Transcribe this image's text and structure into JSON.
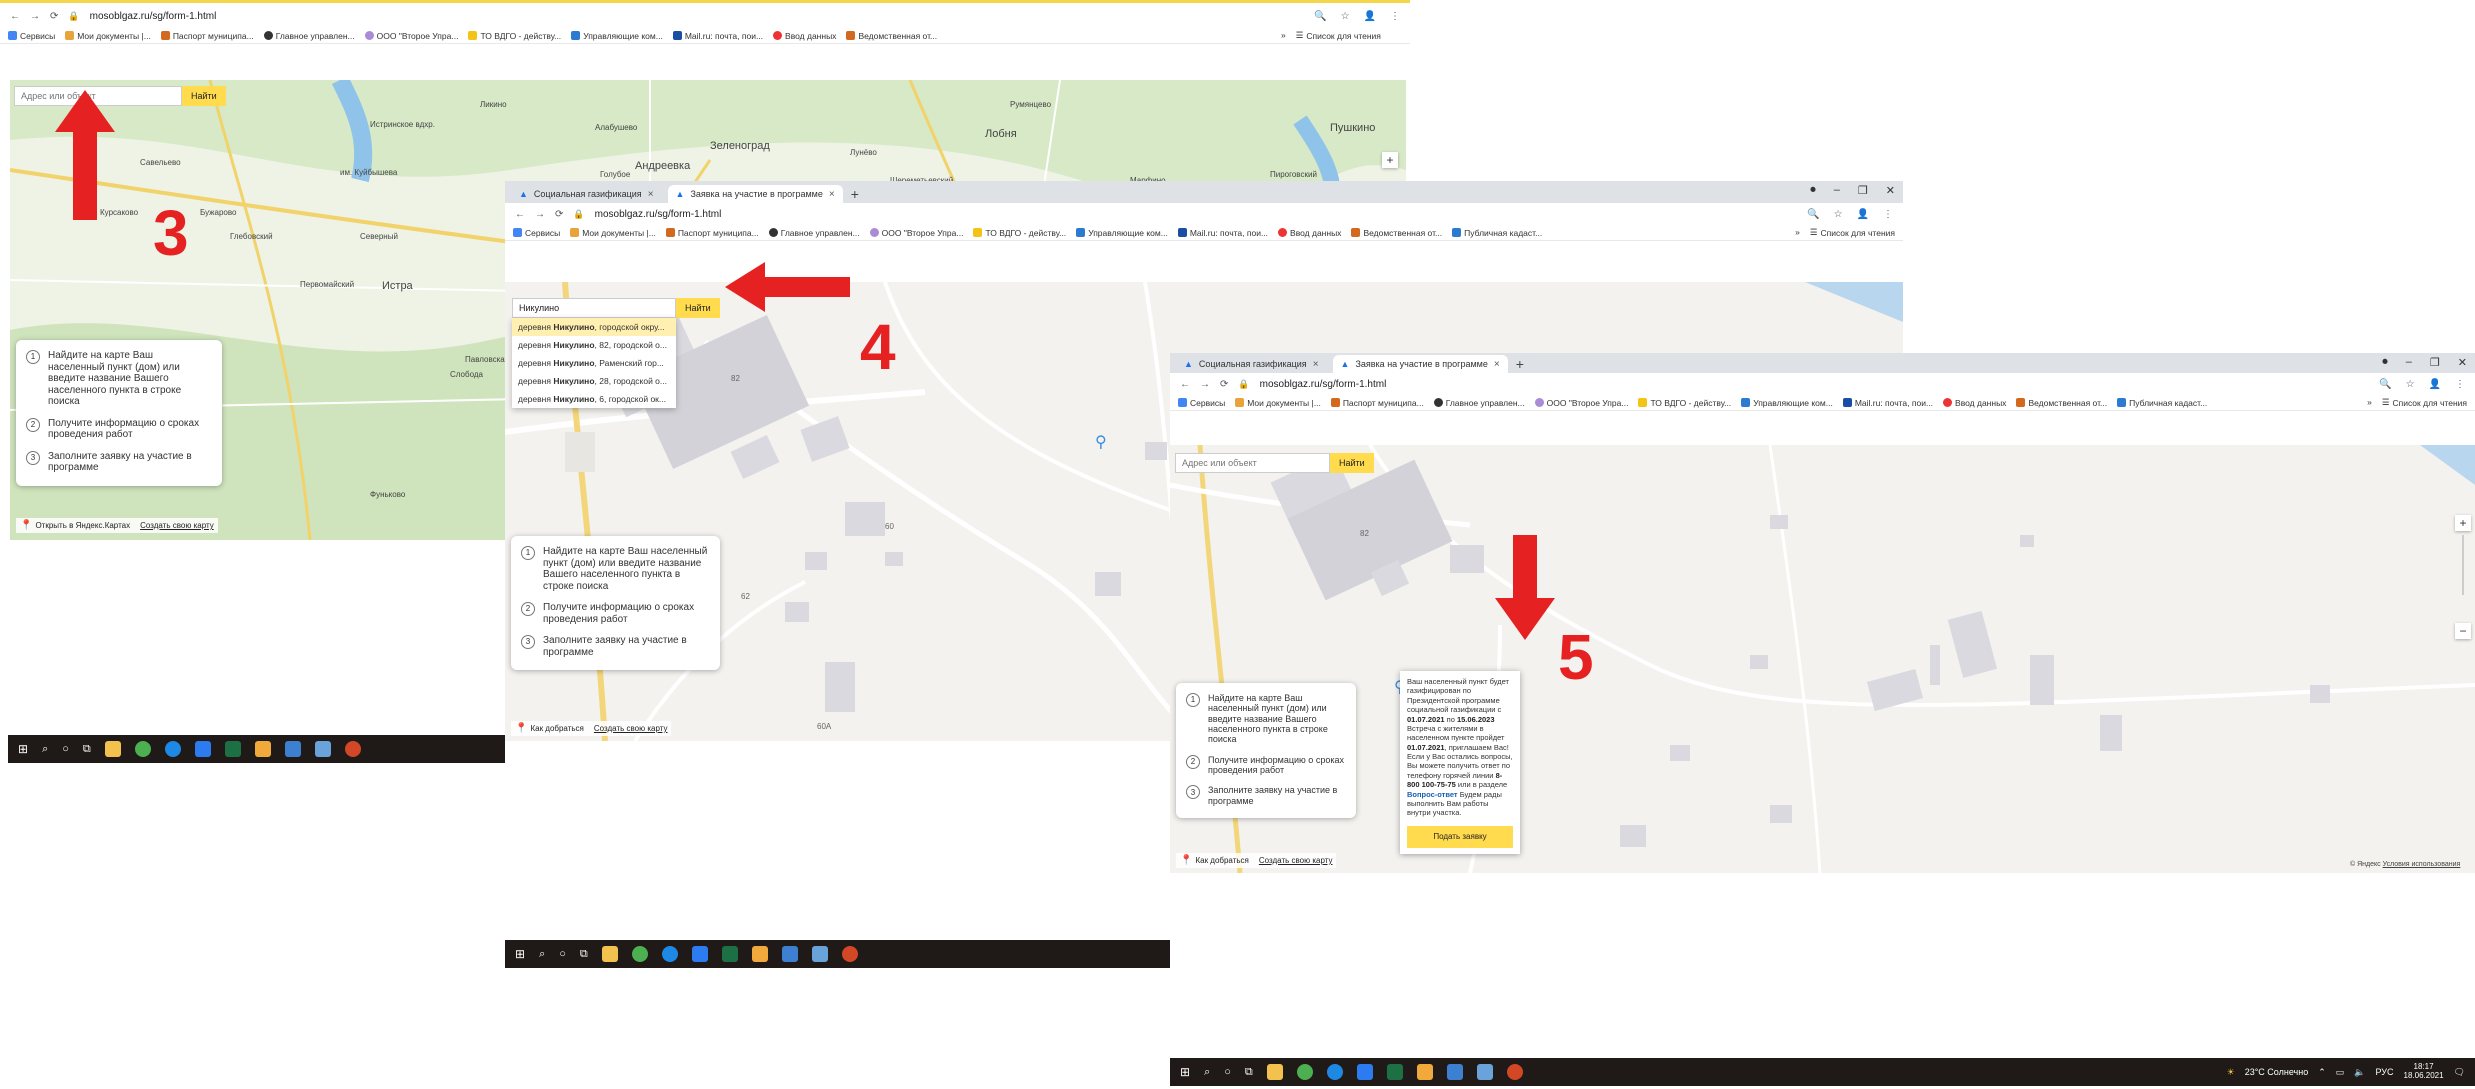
{
  "browser": {
    "url": "mosoblgaz.ru/sg/form-1.html",
    "tabs": [
      "Социальная газификация",
      "Заявка на участие в программе"
    ],
    "new_tab": "+",
    "bookmarks": [
      "Сервисы",
      "Мои документы |...",
      "Паспорт муниципа...",
      "Главное управлен...",
      "ООО \"Второе Упра...",
      "ТО ВДГО - действу...",
      "Управляющие ком...",
      "Mail.ru: почта, пои...",
      "Ввод данных",
      "Ведомственная от...",
      "Публичная кадаст..."
    ],
    "reading_list": "Список для чтения",
    "more": "»"
  },
  "search": {
    "placeholder": "Адрес или объект",
    "button": "Найти",
    "typed_value": "Никулино"
  },
  "suggestions": [
    {
      "pre": "деревня ",
      "hl": "Никулино",
      "post": ", городской окру..."
    },
    {
      "pre": "деревня ",
      "hl": "Никулино",
      "post": ", 82, городской о..."
    },
    {
      "pre": "деревня ",
      "hl": "Никулино",
      "post": ", Раменский гор..."
    },
    {
      "pre": "деревня ",
      "hl": "Никулино",
      "post": ", 28, городской о..."
    },
    {
      "pre": "деревня ",
      "hl": "Никулино",
      "post": ", 6, городской ок..."
    }
  ],
  "steps": [
    {
      "n": "1",
      "text": "Найдите на карте Ваш населенный пункт (дом) или введите название Вашего населенного пункта в строке поиска"
    },
    {
      "n": "2",
      "text": "Получите информацию о сроках проведения работ"
    },
    {
      "n": "3",
      "text": "Заполните заявку на участие в программе"
    }
  ],
  "map_footer": {
    "open_yandex": "Открыть в Яндекс.Картах",
    "directions": "Как добраться",
    "create_map": "Создать свою карту"
  },
  "map_labels_overview": [
    "Савельево",
    "Бужарово",
    "Истринское вдхр.",
    "им. Куйбышева",
    "Курсаково",
    "Глебовский",
    "Северный",
    "Первомайский",
    "Истра",
    "Павловская",
    "Слобода",
    "Андреевка",
    "Зеленоград",
    "Лобня",
    "Пушкино",
    "Алабушево",
    "Лунёво",
    "Голубое",
    "Шереметьевский",
    "Марфино",
    "Пироговский",
    "Поведники",
    "Фуньково",
    "Румянцево",
    "Ликино"
  ],
  "building_numbers": [
    "82",
    "60",
    "62",
    "60А"
  ],
  "annotations": [
    "3",
    "4",
    "5"
  ],
  "popup": {
    "line1": "Ваш населенный пункт будет газифицирован по Президентской программе социальной газификации с",
    "date_from": "01.07.2021",
    "conj1": "по",
    "date_to": "15.06.2023",
    "line2": "Встреча с жителями в населенном пункте пройдет",
    "meeting_date": "01.07.2021",
    "line3": ", приглашаем Вас! Если у Вас остались вопросы, Вы можете получить ответ по телефону горячей линии",
    "phone": "8-800 100-75-75",
    "line4": "или в разделе",
    "faq": "Вопрос-ответ",
    "line5": "Будем рады выполнить Вам работы внутри участка.",
    "button": "Подать заявку"
  },
  "yandex_footer": {
    "copy": "© Яндекс",
    "terms": "Условия использования"
  },
  "tray": {
    "weather": "23°C  Солнечно",
    "lang": "РУС",
    "time": "18:17",
    "date": "18.06.2021"
  },
  "colors": {
    "accent": "#ffdb4d",
    "annotation": "#e52121",
    "taskbar": "#1f1a17"
  }
}
